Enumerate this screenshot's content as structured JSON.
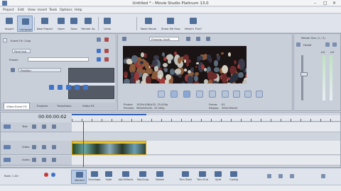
{
  "window": {
    "title": "Untitled * - Movie Studio Platinum 13.0"
  },
  "menu": [
    "Project",
    "Edit",
    "View",
    "Insert",
    "Tools",
    "Options",
    "Help"
  ],
  "toolbar": {
    "buttons": [
      {
        "label": "Import",
        "icon": "import-icon"
      },
      {
        "label": "Compose",
        "icon": "compose-icon",
        "active": true
      },
      {
        "label": "New Project",
        "icon": "new-project-icon"
      },
      {
        "label": "Open",
        "icon": "open-icon"
      },
      {
        "label": "Save",
        "icon": "save-icon"
      },
      {
        "label": "Render As",
        "icon": "render-icon"
      },
      {
        "label": "Undo",
        "icon": "undo-icon"
      },
      {
        "label": "Make Movie",
        "icon": "make-movie-icon"
      },
      {
        "label": "Show Me How",
        "icon": "show-me-how-icon"
      },
      {
        "label": "What's This?",
        "icon": "whats-this-icon"
      }
    ]
  },
  "fx_panel": {
    "header": "Event FX: Crop",
    "preset_label": "Preset:",
    "position_label": "Position",
    "sub_button": "Pan/Crop"
  },
  "left_tabs": [
    "Video Event FX",
    "Explorer",
    "Transitions",
    "Video FX"
  ],
  "preview": {
    "mode": "Preview (Half)",
    "info": {
      "project_label": "Project:",
      "project_value": "1920x1080x32, 25.000p",
      "preview_label": "Preview:",
      "preview_value": "960x540x32, 25.000p",
      "display_label": "Display:",
      "display_value": "349x196x32",
      "frame_label": "Frame:",
      "frame_value": "61"
    }
  },
  "mixer": {
    "title": "Master Bus (1 / 2)",
    "left_label": "Faded",
    "values": [
      "-Inf",
      "-Inf"
    ]
  },
  "timeline": {
    "timecode": "00:00:00:02",
    "tracks": [
      {
        "name": "Text",
        "type": "text"
      },
      {
        "name": "Video",
        "type": "video"
      },
      {
        "name": "Audio",
        "type": "audio"
      }
    ],
    "rate_label": "Rate: 1.00"
  },
  "bottom_toolbar": [
    {
      "label": "Normal",
      "icon": "normal-tool-icon",
      "active": true
    },
    {
      "label": "Envelope",
      "icon": "envelope-tool-icon"
    },
    {
      "label": "Fade",
      "icon": "fade-tool-icon"
    },
    {
      "label": "Add Effects",
      "icon": "add-effects-icon"
    },
    {
      "label": "Pan/Crop",
      "icon": "pan-crop-icon"
    },
    {
      "label": "Delete",
      "icon": "delete-icon"
    },
    {
      "label": "Trim Start",
      "icon": "trim-start-icon"
    },
    {
      "label": "Trim End",
      "icon": "trim-end-icon"
    },
    {
      "label": "Split",
      "icon": "split-icon"
    },
    {
      "label": "Config",
      "icon": "config-icon"
    }
  ],
  "colors": {
    "accent": "#2f5fb4",
    "clip_border": "#cf9a00",
    "playhead": "#d02020"
  }
}
